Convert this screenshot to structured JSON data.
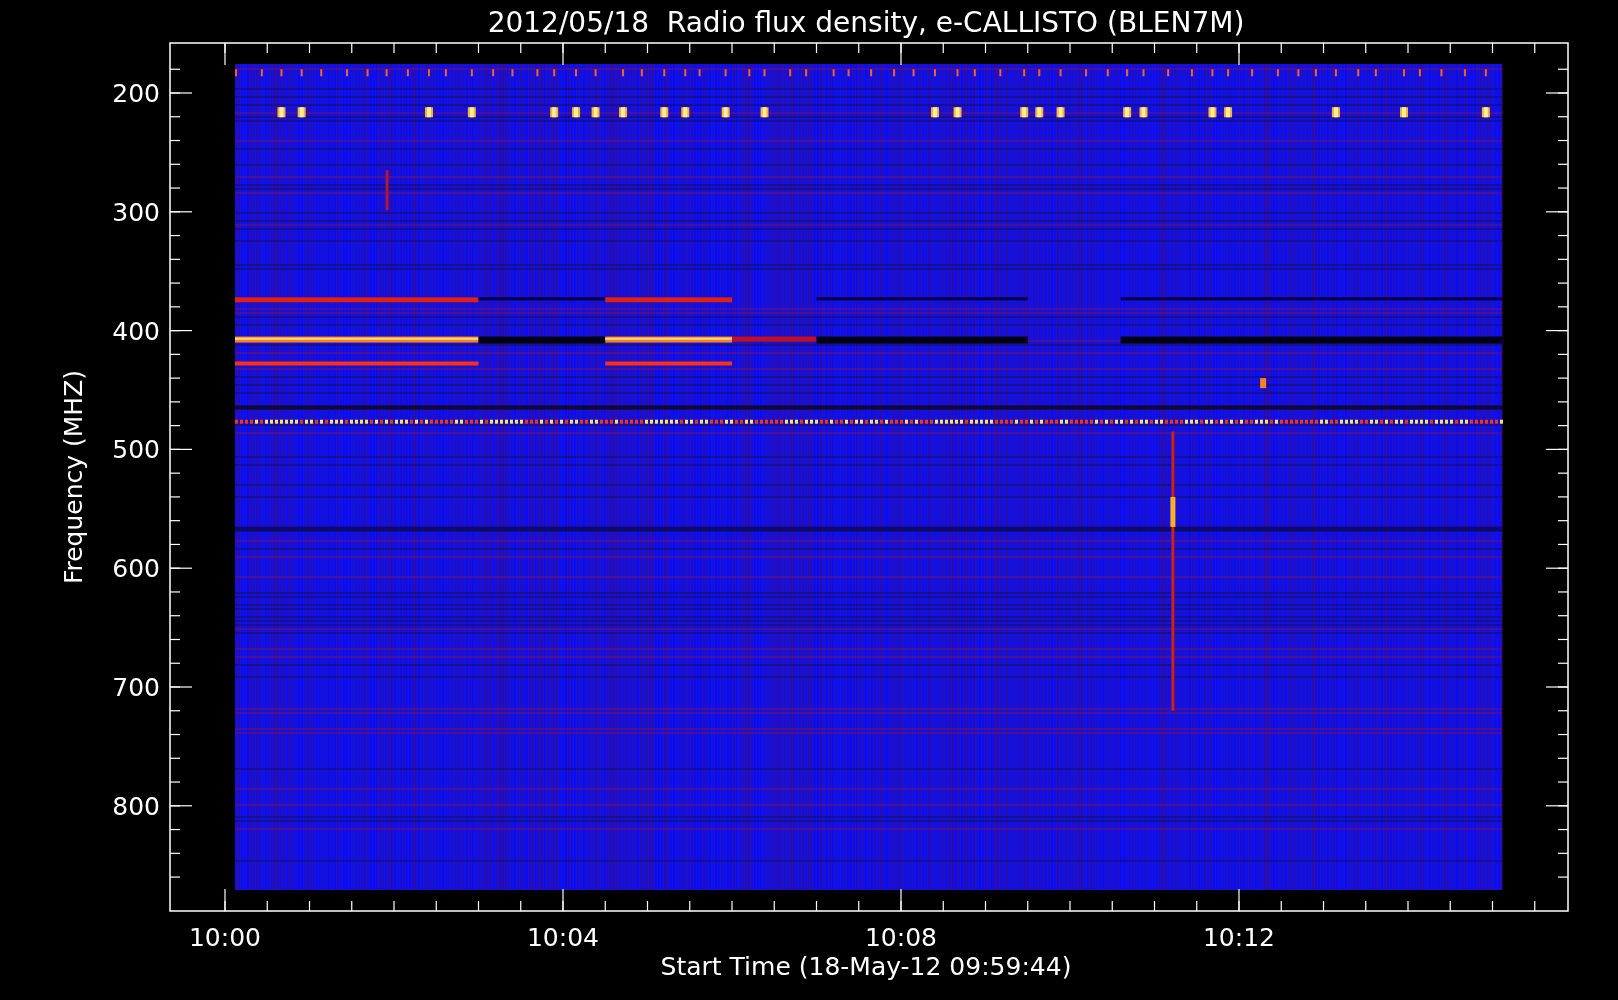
{
  "title": "2012/05/18  Radio flux density, e-CALLISTO (BLEN7M)",
  "y_axis": {
    "label": "Frequency (MHZ)",
    "ticks": [
      "200",
      "300",
      "400",
      "500",
      "600",
      "700",
      "800"
    ]
  },
  "x_axis": {
    "label": "Start Time (18-May-12 09:59:44)",
    "ticks": [
      "10:00",
      "10:04",
      "10:08",
      "10:12"
    ]
  }
}
